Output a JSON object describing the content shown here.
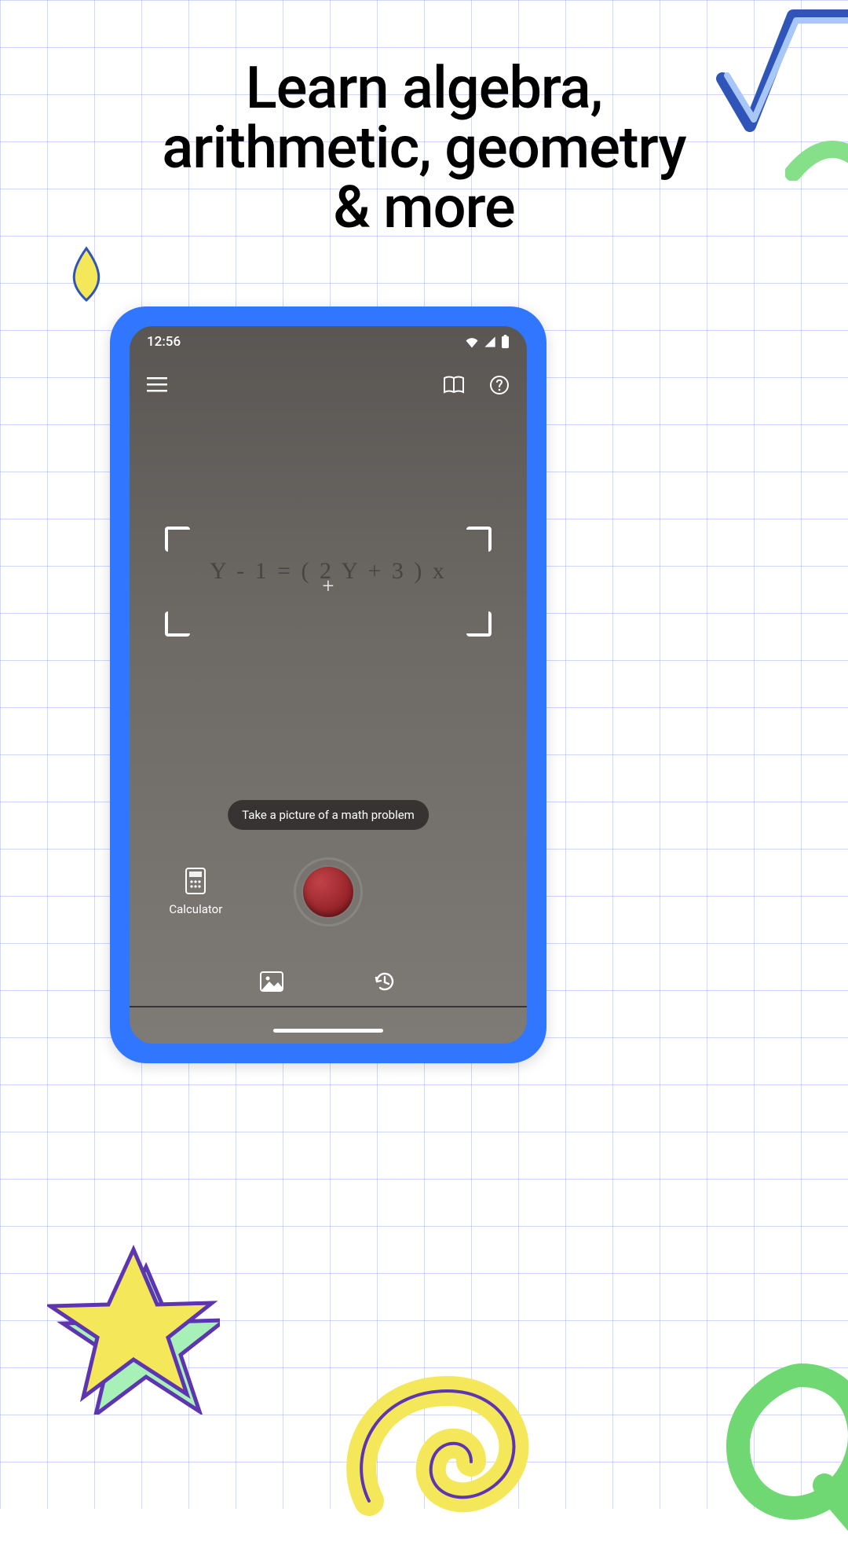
{
  "headline": "Learn algebra,\narithmetic, geometry\n& more",
  "statusbar": {
    "time": "12:56"
  },
  "camera": {
    "equation": "Y - 1 = ( 2 Y + 3 ) x",
    "hint": "Take a picture of a math problem"
  },
  "controls": {
    "calculator_label": "Calculator"
  },
  "icons": {
    "menu": "menu-icon",
    "book": "book-icon",
    "help": "help-icon",
    "wifi": "wifi-icon",
    "signal": "signal-icon",
    "battery": "battery-icon",
    "calculator": "calculator-icon",
    "gallery": "image-icon",
    "history": "history-icon"
  },
  "colors": {
    "accent": "#3076ff",
    "shutter": "#a32a2f"
  }
}
